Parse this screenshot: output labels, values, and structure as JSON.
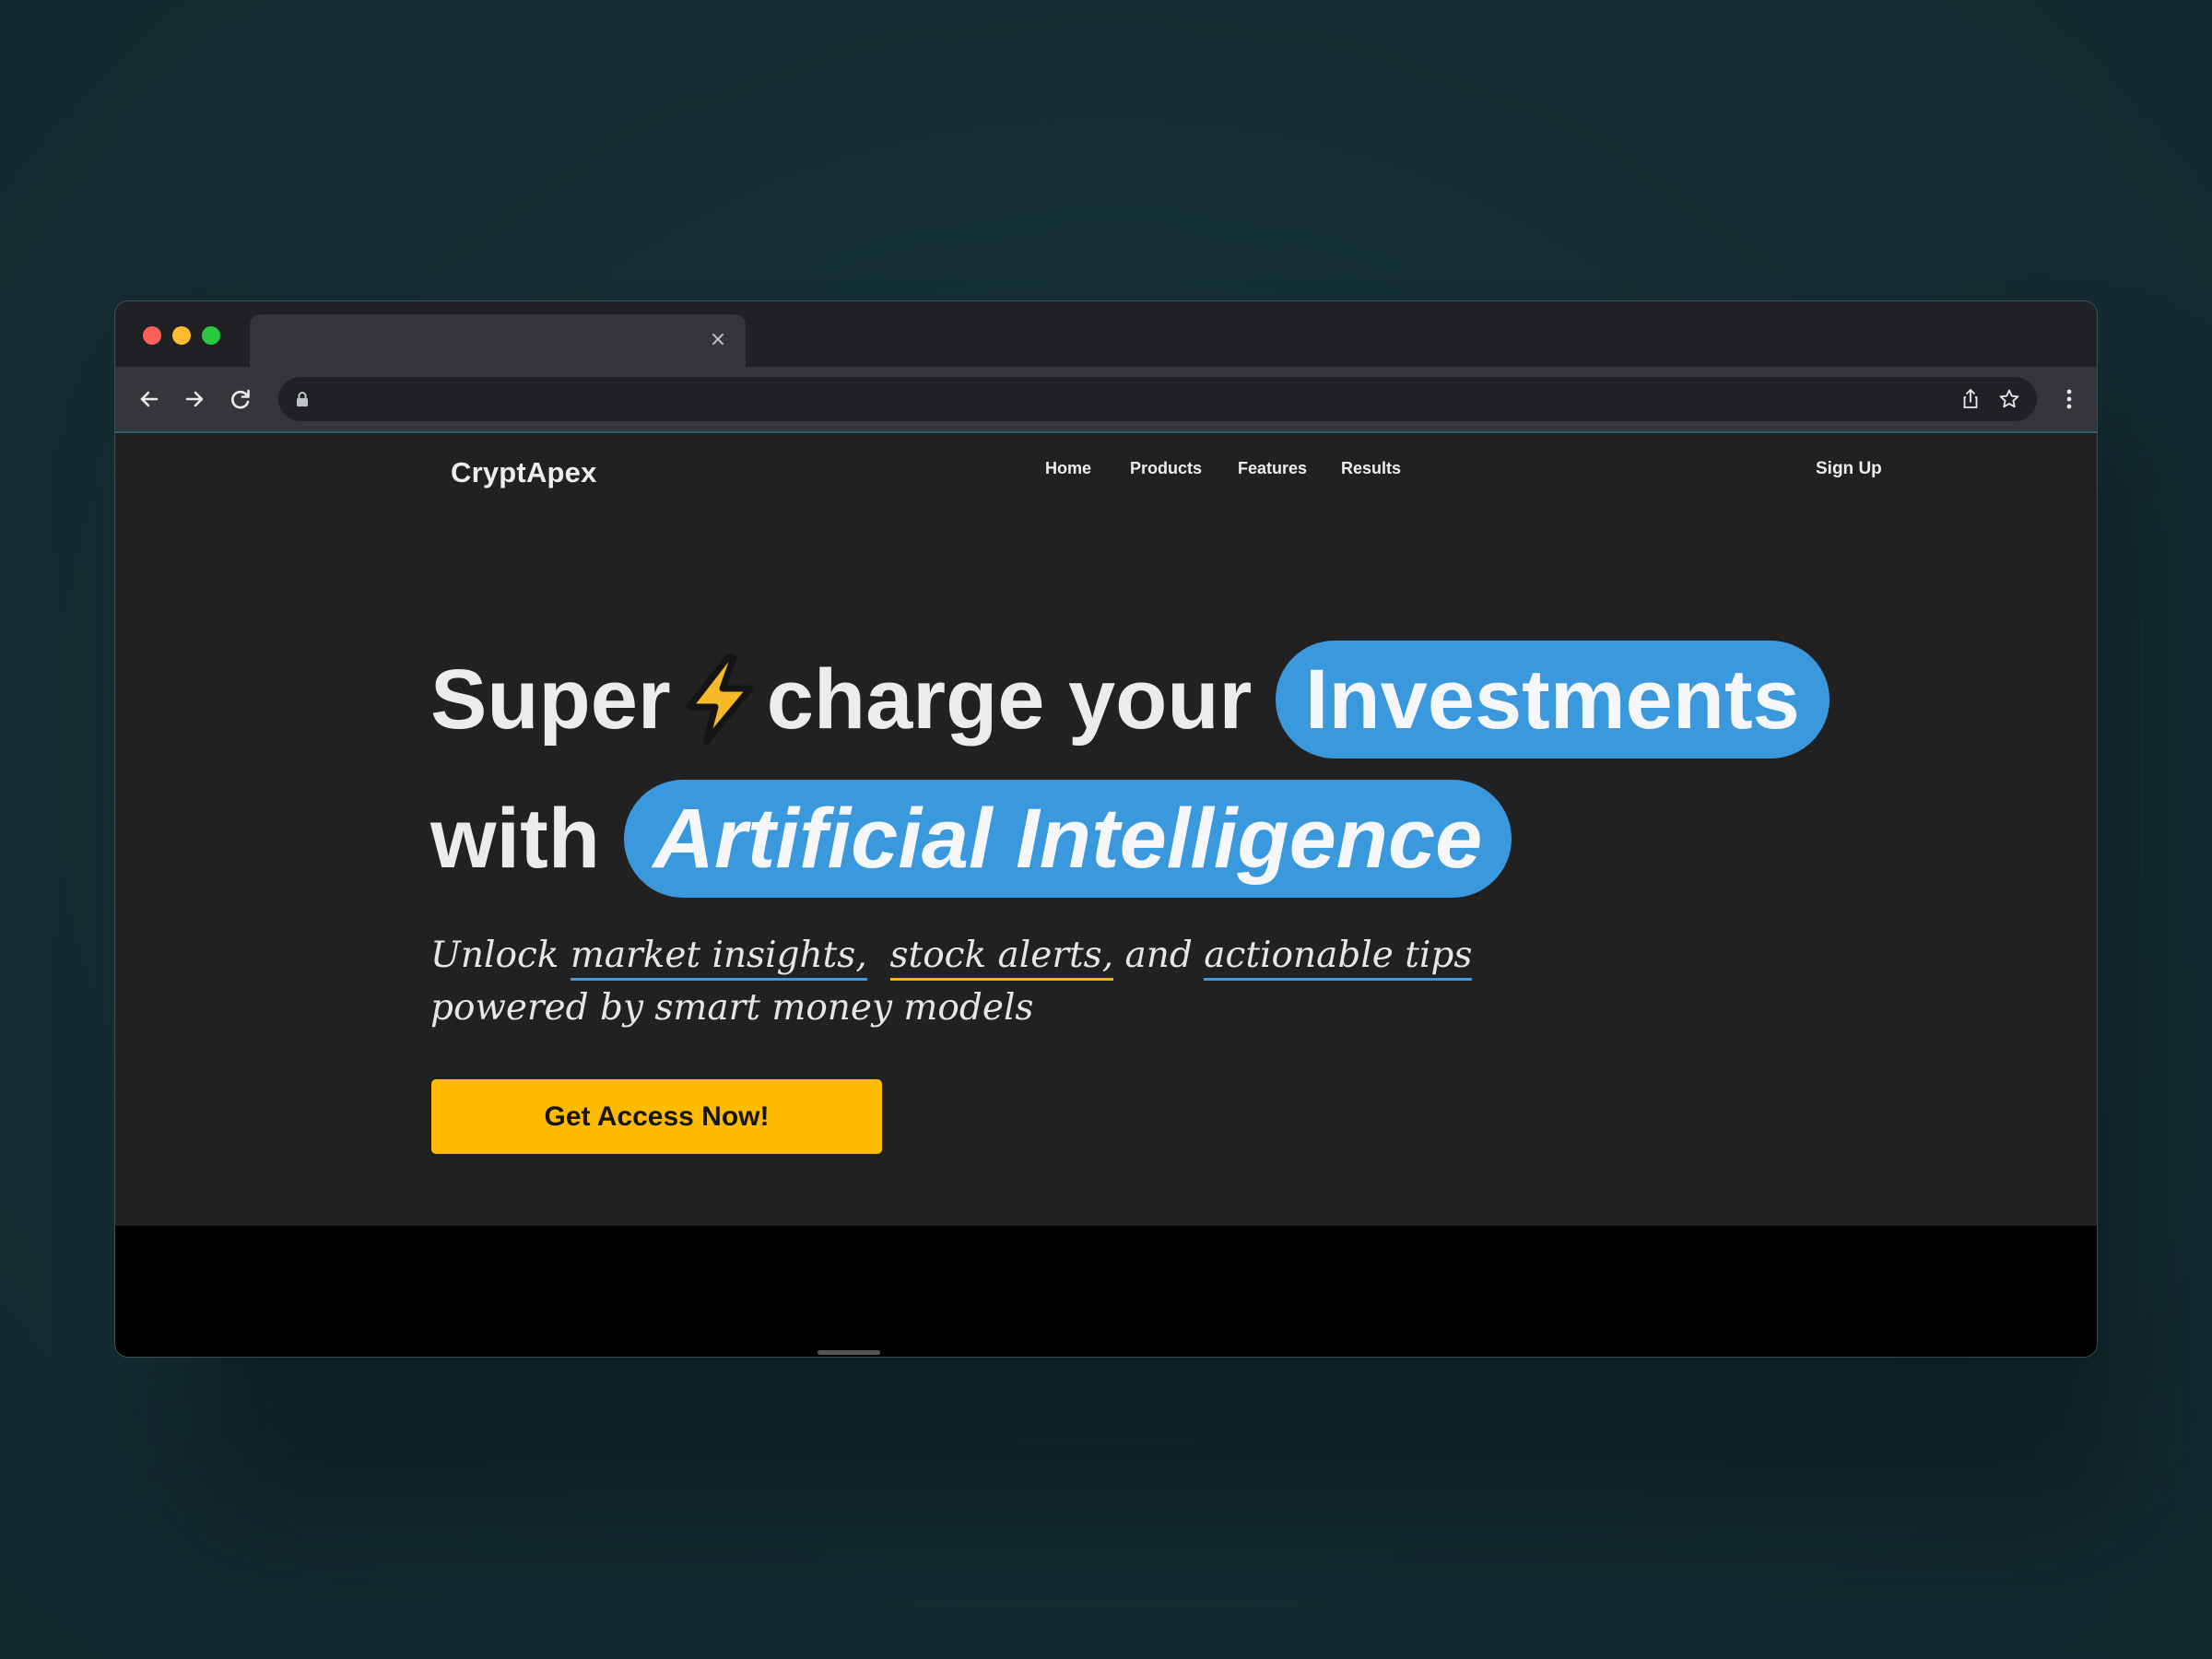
{
  "browser": {
    "tab_close_glyph": "×",
    "url": "",
    "icons": [
      "back-arrow-icon",
      "forward-arrow-icon",
      "reload-icon",
      "lock-icon",
      "share-icon",
      "star-icon",
      "kebab-menu-icon"
    ]
  },
  "site": {
    "brand": "CryptApex",
    "nav": [
      "Home",
      "Products",
      "Features",
      "Results"
    ],
    "signup": "Sign Up"
  },
  "hero": {
    "line1_word1": "Super",
    "line1_rest": "charge your",
    "line1_pill": "Investments",
    "line2_word": "with",
    "line2_pill": "Artificial Intelligence",
    "sub_unlock": "Unlock ",
    "sub_link1": "market insights,",
    "sub_link2": "stock alerts,",
    "sub_and": " and ",
    "sub_link3": "actionable tips",
    "sub_line2": "powered by smart money models",
    "cta": "Get Access Now!"
  },
  "colors": {
    "background": "#152f34",
    "page": "#212121",
    "accent_blue": "#3a98dd",
    "accent_yellow": "#ffbb00"
  }
}
